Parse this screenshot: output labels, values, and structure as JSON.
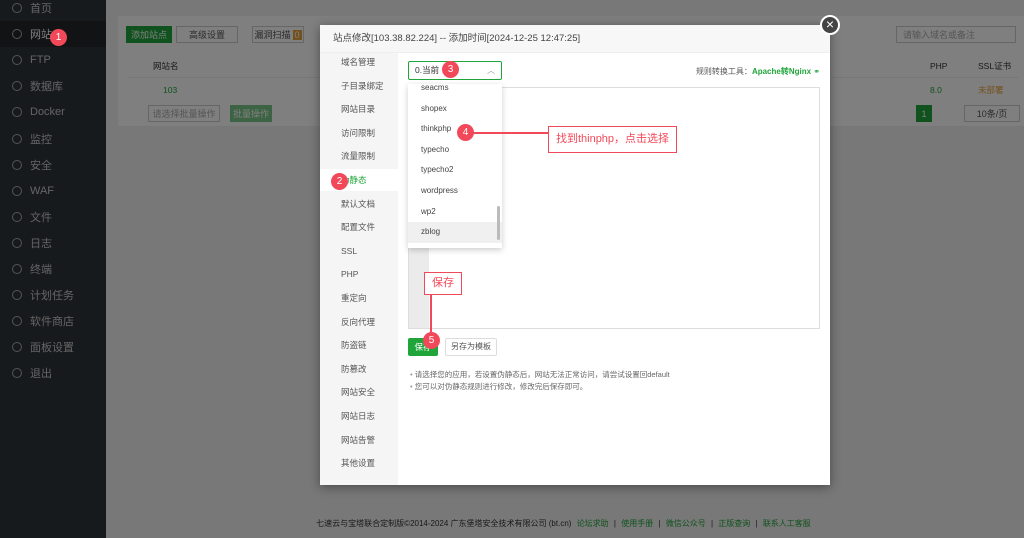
{
  "sidebar": {
    "items": [
      {
        "label": "首页"
      },
      {
        "label": "网站"
      },
      {
        "label": "FTP"
      },
      {
        "label": "数据库"
      },
      {
        "label": "Docker"
      },
      {
        "label": "监控"
      },
      {
        "label": "安全"
      },
      {
        "label": "WAF"
      },
      {
        "label": "文件"
      },
      {
        "label": "日志"
      },
      {
        "label": "终端"
      },
      {
        "label": "计划任务"
      },
      {
        "label": "软件商店"
      },
      {
        "label": "面板设置"
      },
      {
        "label": "退出"
      }
    ],
    "active": "网站"
  },
  "toolbar": {
    "add_site": "添加站点",
    "advanced": "高级设置",
    "vuln_scan": "漏洞扫描",
    "vuln_count": "0",
    "search_placeholder": "请输入域名或备注"
  },
  "table": {
    "headers": {
      "name": "网站名",
      "php": "PHP",
      "ssl": "SSL证书"
    },
    "rows": [
      {
        "name": "103",
        "php": "8.0",
        "ssl": "未部署"
      }
    ],
    "batch_placeholder": "请选择批量操作",
    "batch_button": "批量操作",
    "page": "1",
    "page_size": "10条/页"
  },
  "footer": {
    "copyright": "七速云与宝塔联合定制版©2014-2024 广东堡塔安全技术有限公司 (bt.cn)",
    "links": [
      "论坛求助",
      "使用手册",
      "微信公众号",
      "正版查询",
      "联系人工客服"
    ]
  },
  "modal": {
    "title": "站点修改[103.38.82.224] -- 添加时间[2024-12-25 12:47:25]",
    "nav": [
      "域名管理",
      "子目录绑定",
      "网站目录",
      "访问限制",
      "流量限制",
      "伪静态",
      "默认文档",
      "配置文件",
      "SSL",
      "PHP",
      "重定向",
      "反向代理",
      "防盗链",
      "防篡改",
      "网站安全",
      "网站日志",
      "网站告警",
      "其他设置"
    ],
    "active_nav": "伪静态",
    "select_value": "0.当前",
    "tool_label": "规则转换工具：",
    "tool_link": "Apache转Nginx",
    "options": [
      "seacms",
      "shopex",
      "thinkphp",
      "typecho",
      "typecho2",
      "wordpress",
      "wp2",
      "zblog"
    ],
    "highlighted_option": "zblog",
    "save": "保存",
    "save_as": "另存为模板",
    "tips": [
      "请选择您的应用，若设置伪静态后，网站无法正常访问，请尝试设置回default",
      "您可以对伪静态规则进行修改，修改完后保存即可。"
    ]
  },
  "annotations": {
    "badges": [
      "1",
      "2",
      "3",
      "4",
      "5"
    ],
    "callout_thinkphp": "找到thinphp，点击选择",
    "callout_save": "保存"
  },
  "colors": {
    "accent": "#20a53a",
    "annotation": "#f2495a",
    "sidebar": "#2f343b"
  }
}
